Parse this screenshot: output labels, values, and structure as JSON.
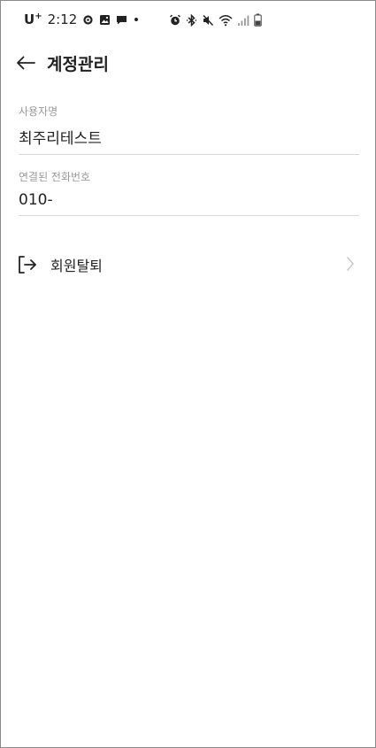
{
  "status_bar": {
    "carrier": "U",
    "carrier_plus": "+",
    "time": "2:12",
    "icons_left": [
      "settings-icon",
      "gallery-icon",
      "message-icon",
      "dot-icon"
    ],
    "icons_right": [
      "alarm-icon",
      "bluetooth-icon",
      "mute-icon",
      "wifi-icon",
      "signal-icon",
      "battery-icon"
    ]
  },
  "header": {
    "title": "계정관리"
  },
  "fields": [
    {
      "label": "사용자명",
      "value": "최주리테스트"
    },
    {
      "label": "연결된 전화번호",
      "value": "010-"
    }
  ],
  "actions": {
    "withdraw_label": "회원탈퇴"
  },
  "colors": {
    "text": "#222222",
    "label": "#9a9a9a",
    "divider": "#d9d9d9",
    "chevron": "#c8c8c8"
  }
}
